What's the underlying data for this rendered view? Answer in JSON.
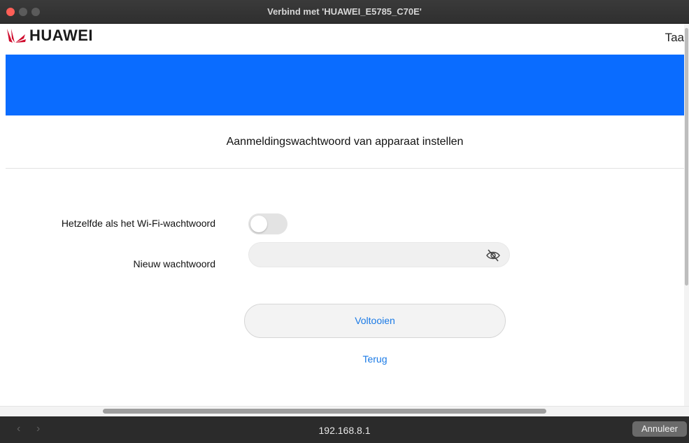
{
  "window": {
    "title": "Verbind met 'HUAWEI_E5785_C70E'"
  },
  "header": {
    "brand": "HUAWEI",
    "language_cut": "Taa",
    "brand_color": "#cf0a2c",
    "band_color": "#0a6cff"
  },
  "main": {
    "title": "Aanmeldingswachtwoord van apparaat instellen",
    "same_as_wifi_label": "Hetzelfde als het Wi-Fi-wachtwoord",
    "same_as_wifi_enabled": false,
    "new_password_label": "Nieuw wachtwoord",
    "new_password_value": "",
    "password_visibility_icon": "eye-slash-icon",
    "finish_button": "Voltooien",
    "back_link": "Terug",
    "accent_color": "#1a7ae6"
  },
  "bottombar": {
    "back": "‹",
    "forward": "›",
    "url": "192.168.8.1",
    "cancel_button": "Annuleer"
  }
}
